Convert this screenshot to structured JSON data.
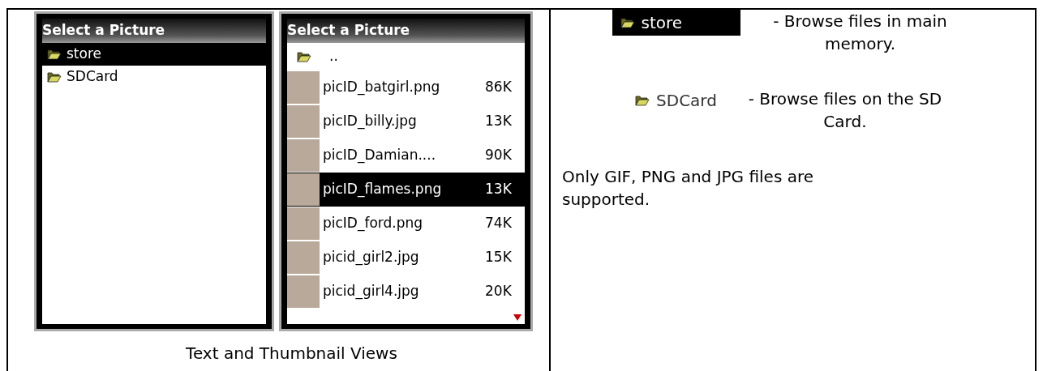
{
  "left_cell": {
    "screens": [
      {
        "title": "Select a Picture",
        "items": [
          {
            "kind": "folder",
            "name": "store",
            "selected": true
          },
          {
            "kind": "folder",
            "name": "SDCard",
            "selected": false
          }
        ]
      },
      {
        "title": "Select a Picture",
        "more_below": true,
        "items": [
          {
            "kind": "folder",
            "name": "..",
            "selected": false
          },
          {
            "kind": "file",
            "name": "picID_batgirl.png",
            "size": "86K",
            "selected": false
          },
          {
            "kind": "file",
            "name": "picID_billy.jpg",
            "size": "13K",
            "selected": false
          },
          {
            "kind": "file",
            "name": "picID_Damian....",
            "size": "90K",
            "selected": false
          },
          {
            "kind": "file",
            "name": "picID_flames.png",
            "size": "13K",
            "selected": true
          },
          {
            "kind": "file",
            "name": "picID_ford.png",
            "size": "74K",
            "selected": false
          },
          {
            "kind": "file",
            "name": "picid_girl2.jpg",
            "size": "15K",
            "selected": false
          },
          {
            "kind": "file",
            "name": "picid_girl4.jpg",
            "size": "20K",
            "selected": false
          }
        ]
      }
    ],
    "caption": "Text and Thumbnail Views"
  },
  "right_cell": {
    "entries": [
      {
        "item": {
          "name": "store",
          "selected": true
        },
        "description": "- Browse files in main memory."
      },
      {
        "item": {
          "name": "SDCard",
          "selected": false
        },
        "description": "- Browse files on the SD Card."
      }
    ],
    "note": "Only GIF, PNG and JPG files are supported."
  }
}
